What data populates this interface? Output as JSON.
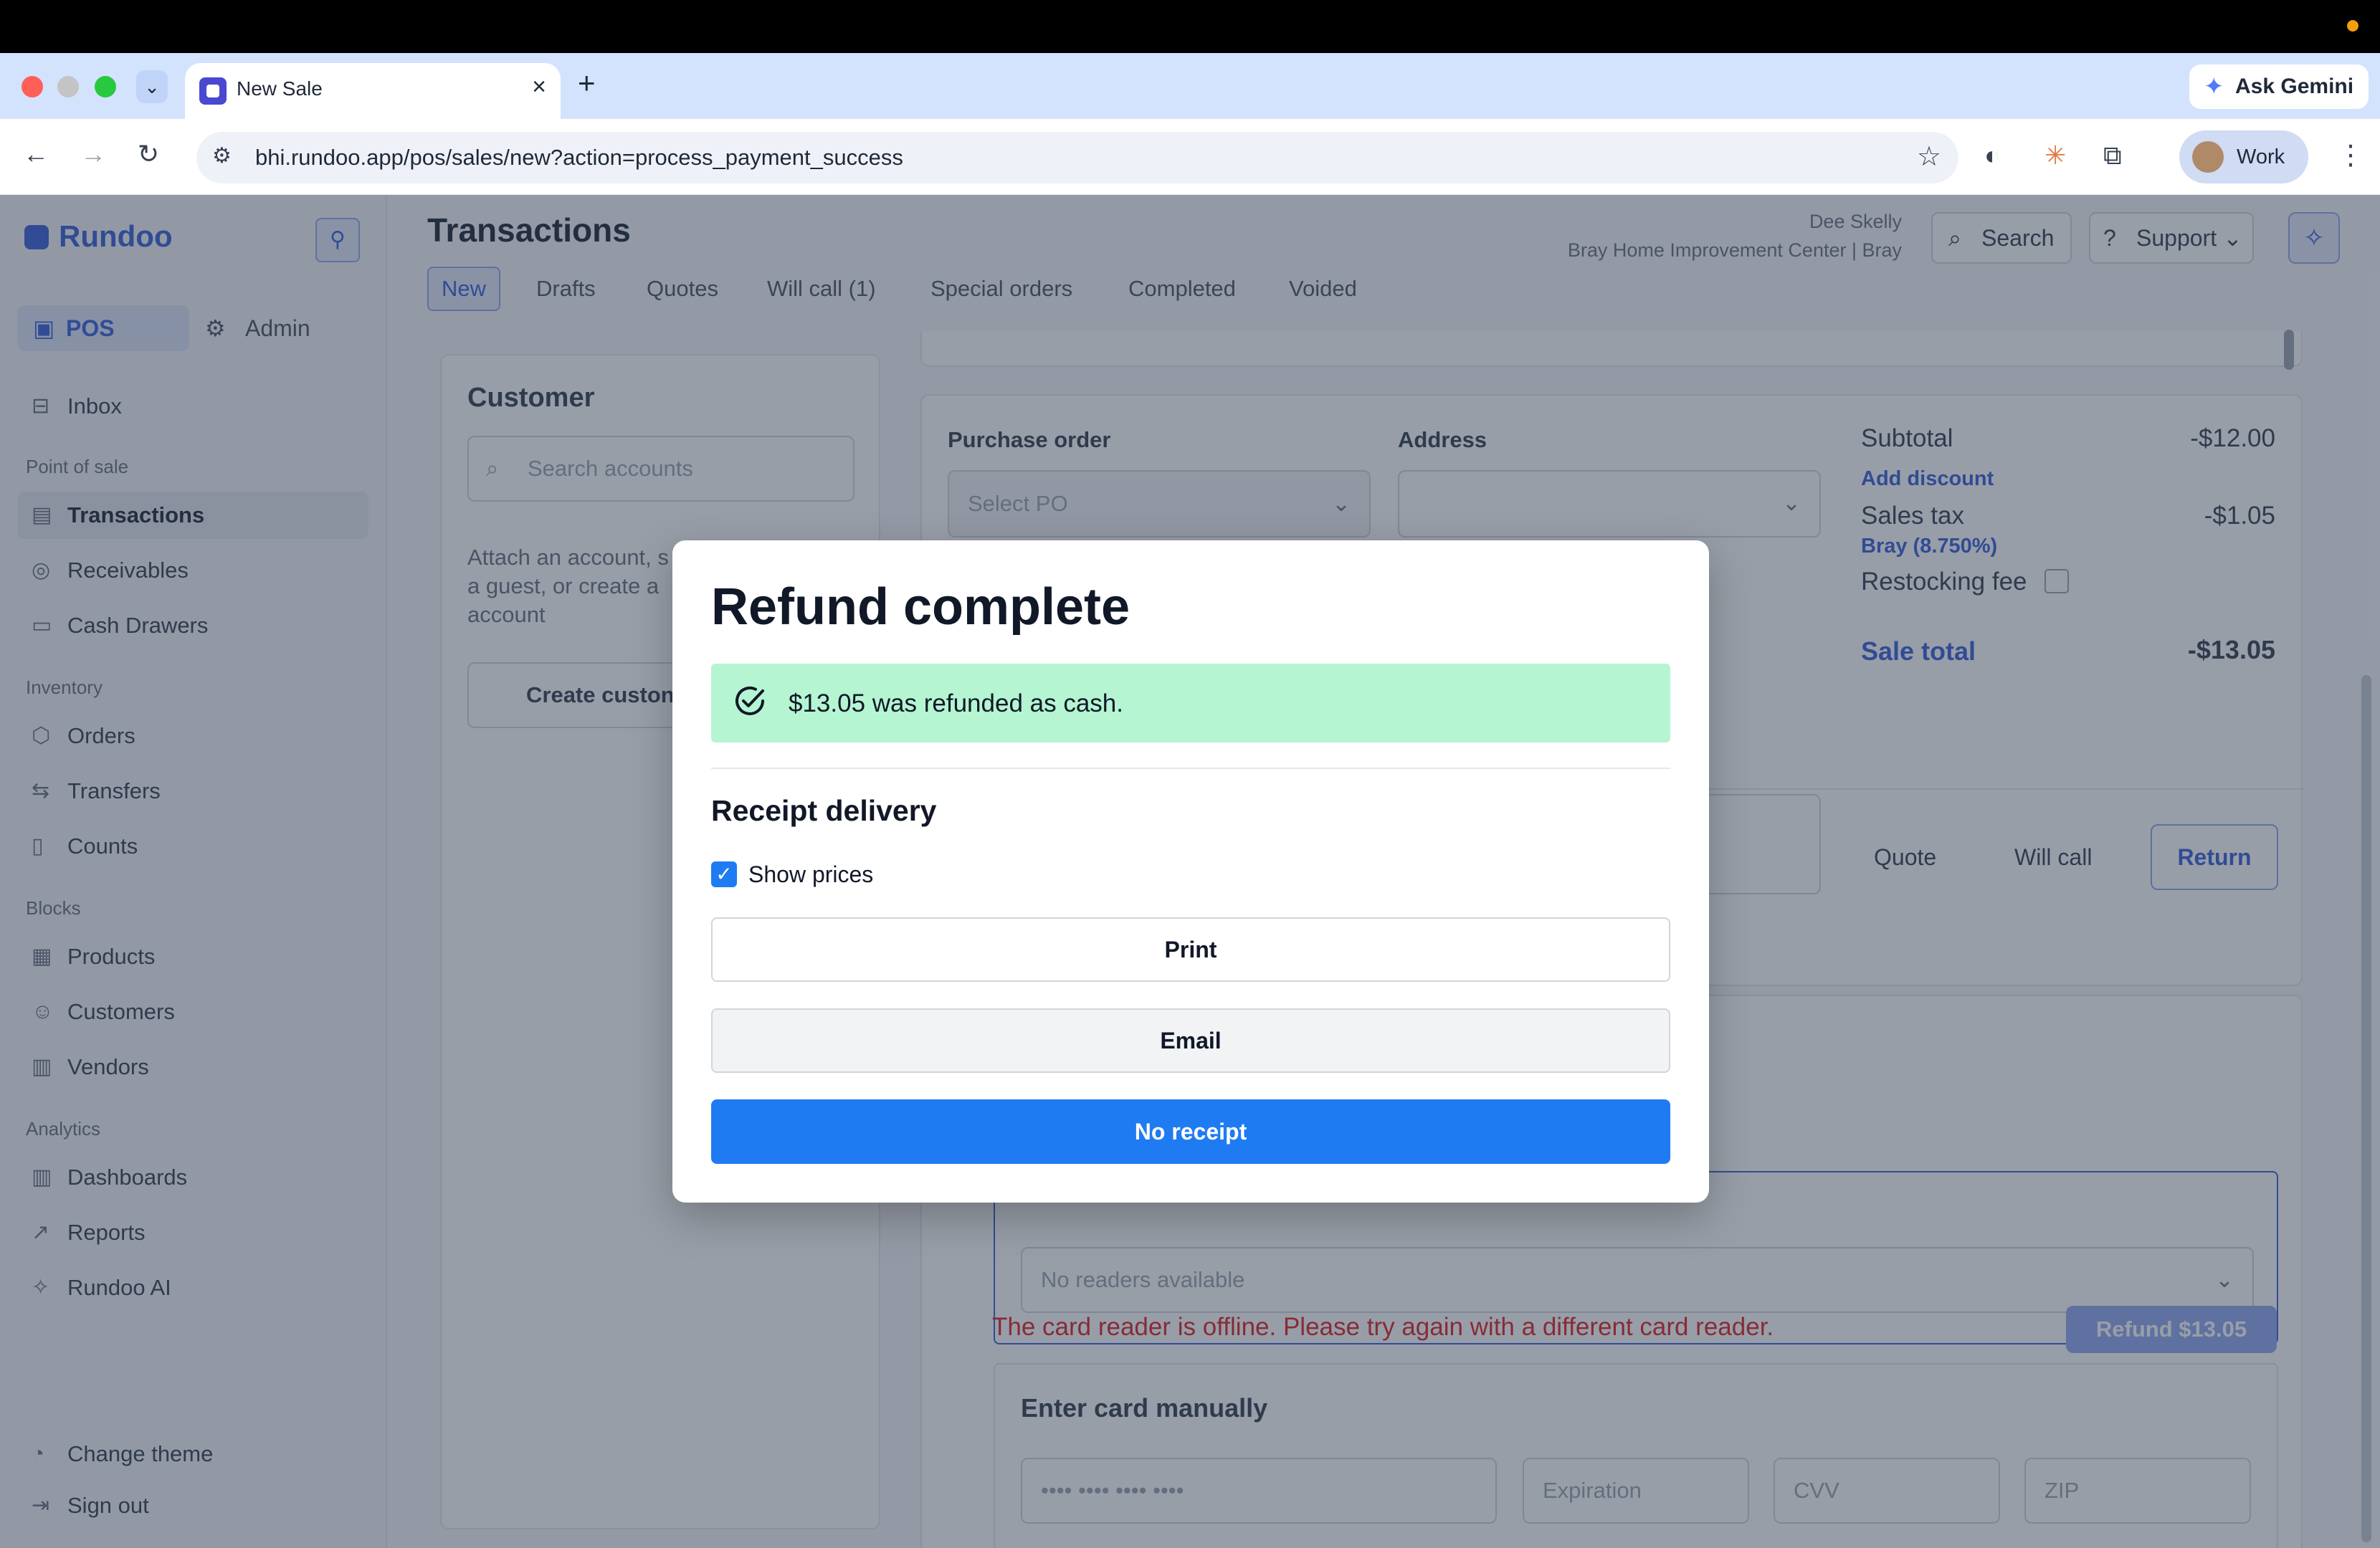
{
  "browser": {
    "tab_title": "New Sale",
    "url": "bhi.rundoo.app/pos/sales/new?action=process_payment_success",
    "ask_gemini": "Ask Gemini",
    "profile": "Work"
  },
  "sidebar": {
    "brand": "Rundoo",
    "modes": {
      "pos": "POS",
      "admin": "Admin"
    },
    "inbox": "Inbox",
    "sections": {
      "point_of_sale": "Point of sale",
      "inventory": "Inventory",
      "blocks": "Blocks",
      "analytics": "Analytics"
    },
    "items": {
      "transactions": "Transactions",
      "receivables": "Receivables",
      "cash_drawers": "Cash Drawers",
      "orders": "Orders",
      "transfers": "Transfers",
      "counts": "Counts",
      "products": "Products",
      "customers": "Customers",
      "vendors": "Vendors",
      "dashboards": "Dashboards",
      "reports": "Reports",
      "rundoo_ai": "Rundoo AI"
    },
    "change_theme": "Change theme",
    "sign_out": "Sign out"
  },
  "header": {
    "title": "Transactions",
    "user": "Dee Skelly",
    "store": "Bray Home Improvement Center | Bray",
    "search": "Search",
    "support": "Support",
    "tabs": {
      "new": "New",
      "drafts": "Drafts",
      "quotes": "Quotes",
      "will_call": "Will call (1)",
      "special_orders": "Special orders",
      "completed": "Completed",
      "voided": "Voided"
    }
  },
  "customer": {
    "title": "Customer",
    "search_placeholder": "Search accounts",
    "help_lines": [
      "Attach an account, s",
      "a guest, or create a",
      "account"
    ],
    "create_button": "Create custon"
  },
  "order": {
    "purchase_order_label": "Purchase order",
    "purchase_order_placeholder": "Select PO",
    "address_label": "Address"
  },
  "summary": {
    "subtotal_label": "Subtotal",
    "subtotal_value": "-$12.00",
    "add_discount": "Add discount",
    "sales_tax_label": "Sales tax",
    "sales_tax_value": "-$1.05",
    "tax_rate": "Bray (8.750%)",
    "restocking_fee": "Restocking fee",
    "sale_total_label": "Sale total",
    "sale_total_value": "-$13.05"
  },
  "actions": {
    "quote": "Quote",
    "will_call": "Will call",
    "return": "Return"
  },
  "payment": {
    "reader_placeholder": "No readers available",
    "manual_title": "Enter card manually",
    "card_number_placeholder": "•••• •••• •••• ••••",
    "expiration_placeholder": "Expiration",
    "cvv_placeholder": "CVV",
    "zip_placeholder": "ZIP",
    "error": "The card reader is offline. Please try again with a different card reader.",
    "refund_button": "Refund $13.05"
  },
  "modal": {
    "title": "Refund complete",
    "success_message": "$13.05 was refunded as cash.",
    "receipt_heading": "Receipt delivery",
    "show_prices": "Show prices",
    "show_prices_checked": true,
    "print": "Print",
    "email": "Email",
    "no_receipt": "No receipt"
  },
  "colors": {
    "brand": "#3b63d8",
    "primary_button": "#1f7bf2",
    "success_bg": "#b5f5d2",
    "error": "#dc2626"
  }
}
